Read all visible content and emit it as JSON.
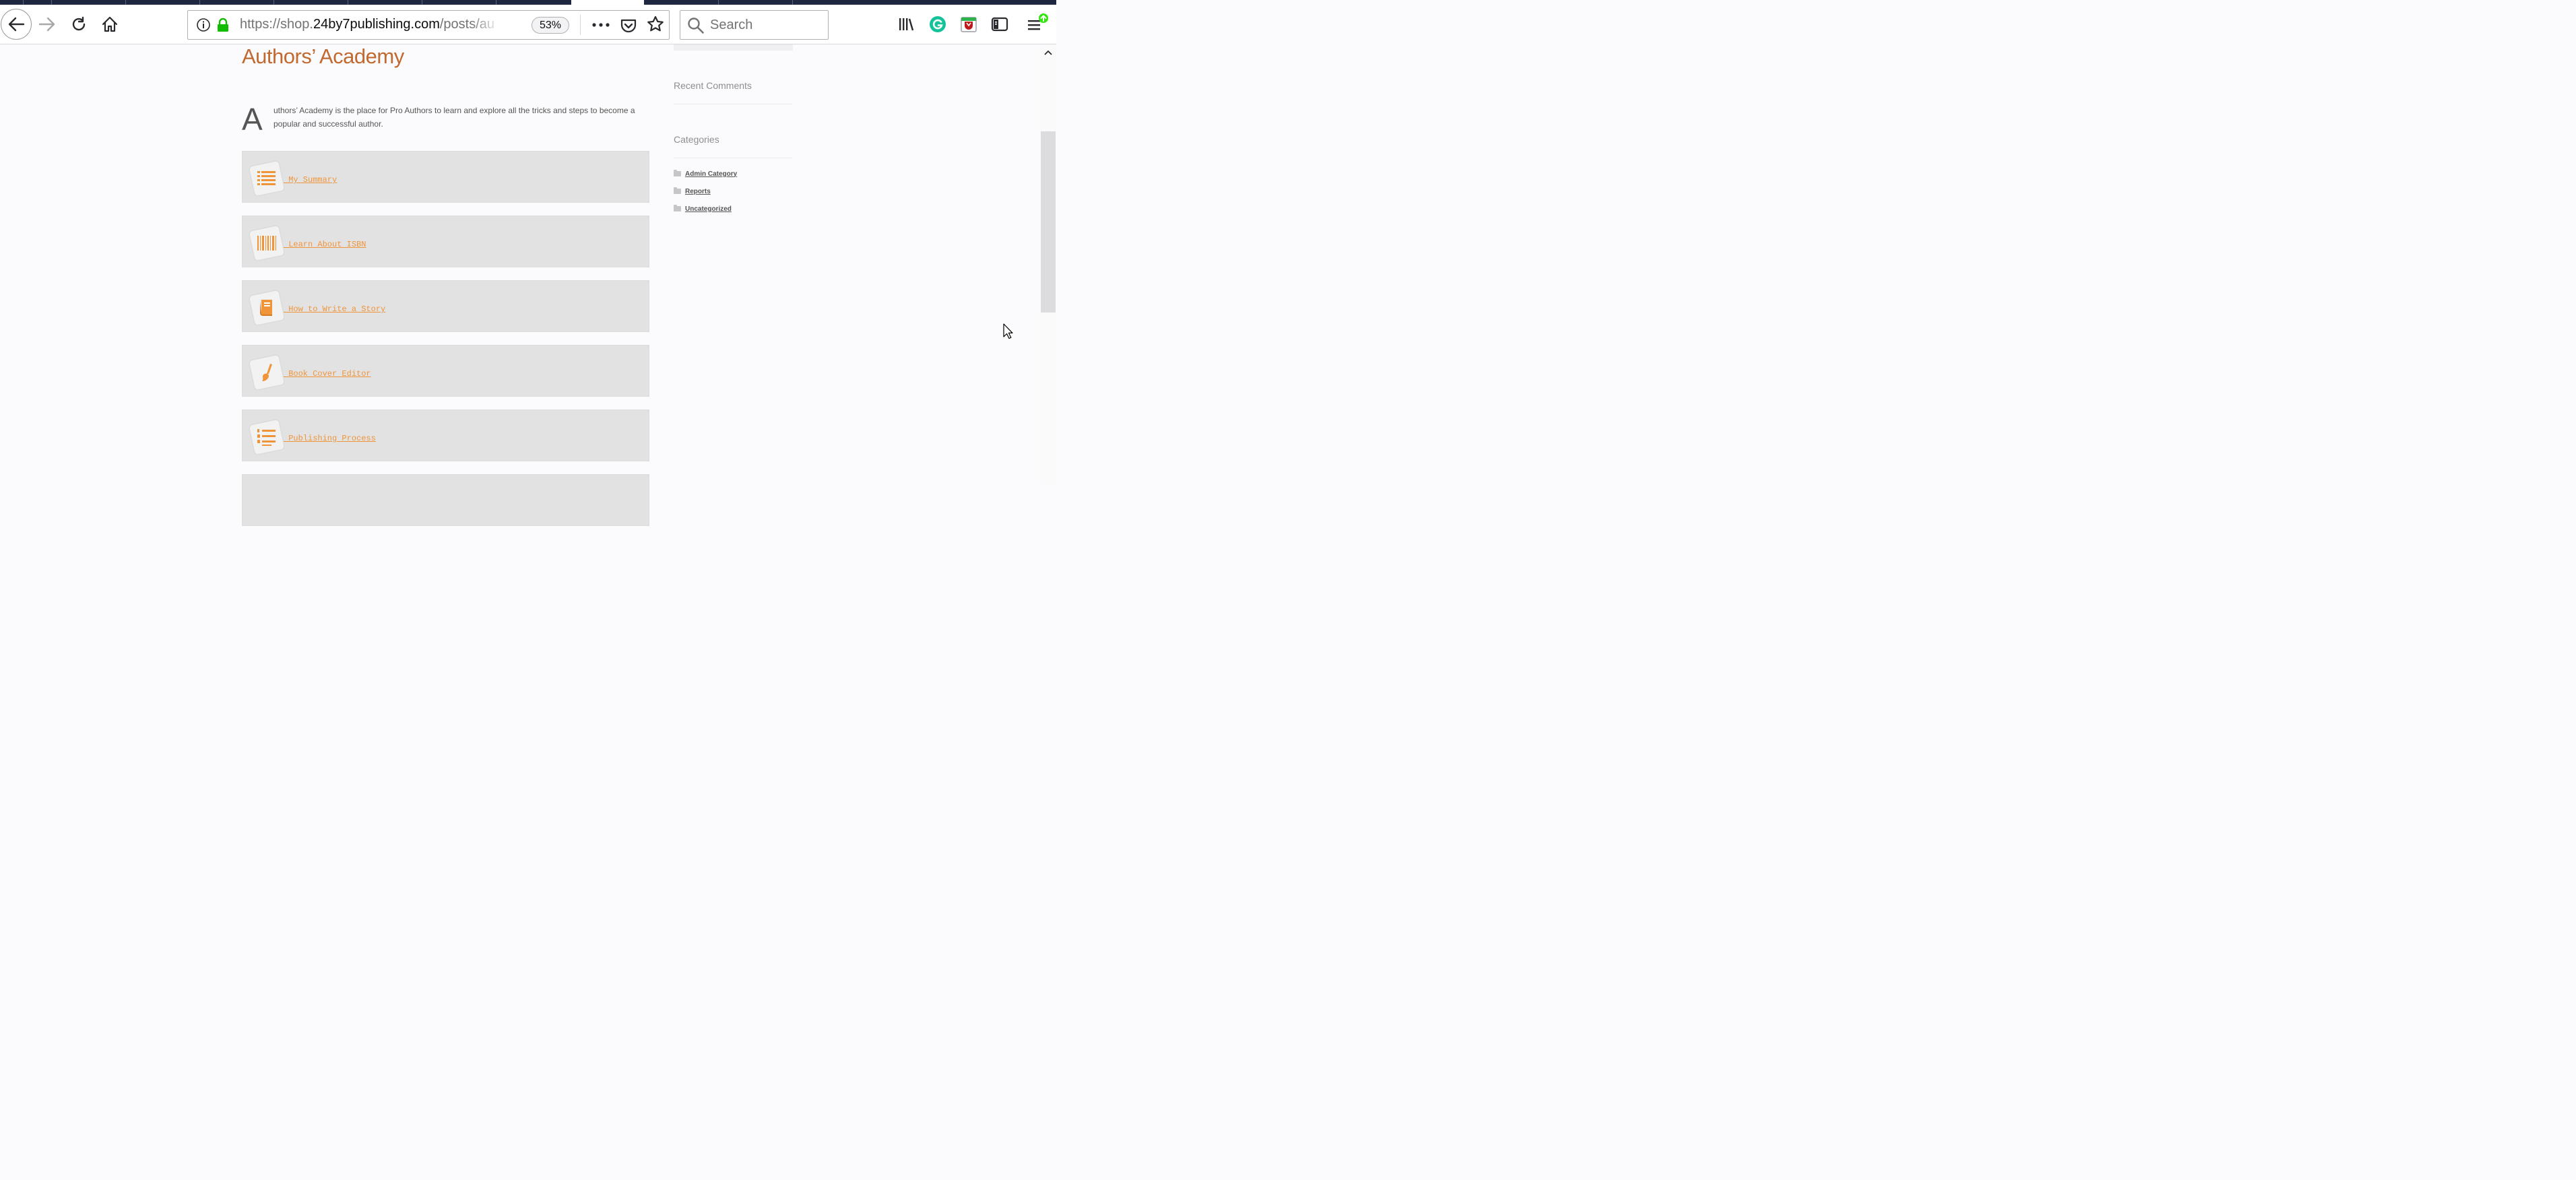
{
  "browser": {
    "url_scheme": "https://shop.",
    "url_domain": "24by7publishing.com",
    "url_path": "/posts/au",
    "zoom": "53%",
    "search_placeholder": "Search"
  },
  "page": {
    "title": "Authors’ Academy",
    "dropcap": "A",
    "intro": "uthors’ Academy is the place for Pro Authors to learn and explore all the tricks and steps to become a popular and successful author.",
    "cards": [
      {
        "label": " My Summary",
        "icon": "list-icon"
      },
      {
        "label": " Learn About ISBN",
        "icon": "barcode-icon"
      },
      {
        "label": " How to Write a Story",
        "icon": "book-icon"
      },
      {
        "label": " Book Cover Editor",
        "icon": "paintbrush-icon"
      },
      {
        "label": " Publishing Process",
        "icon": "numbered-list-icon"
      }
    ]
  },
  "sidebar": {
    "recent_comments_title": "Recent Comments",
    "categories_title": "Categories",
    "categories": [
      "Admin Category",
      "Reports",
      "Uncategorized"
    ]
  },
  "colors": {
    "accent_orange": "#f0943a",
    "title_orange": "#c1692f",
    "card_bg": "#e2e2e3"
  }
}
